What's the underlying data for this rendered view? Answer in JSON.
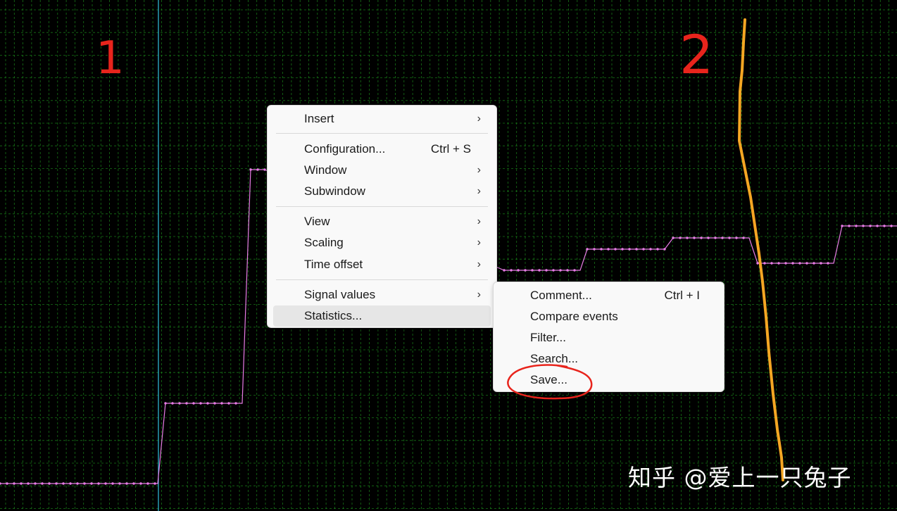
{
  "colors": {
    "background": "#000000",
    "grid": "#1f9a1f",
    "signal": "#e87ce6",
    "cursor": "#33c3e0",
    "annotation_red": "#e8241c",
    "annotation_orange": "#f5a623"
  },
  "annotations": {
    "marker_1": "1",
    "marker_2": "2"
  },
  "context_menu": {
    "items": [
      {
        "label": "Insert",
        "shortcut": "",
        "arrow": "›"
      },
      {
        "label": "Configuration...",
        "shortcut": "Ctrl + S",
        "arrow": ""
      },
      {
        "label": "Window",
        "shortcut": "",
        "arrow": "›"
      },
      {
        "label": "Subwindow",
        "shortcut": "",
        "arrow": "›"
      },
      {
        "label": "View",
        "shortcut": "",
        "arrow": "›"
      },
      {
        "label": "Scaling",
        "shortcut": "",
        "arrow": "›"
      },
      {
        "label": "Time offset",
        "shortcut": "",
        "arrow": "›"
      },
      {
        "label": "Signal values",
        "shortcut": "",
        "arrow": "›"
      },
      {
        "label": "Statistics...",
        "shortcut": "",
        "arrow": ""
      }
    ]
  },
  "submenu": {
    "items": [
      {
        "label": "Comment...",
        "shortcut": "Ctrl + I"
      },
      {
        "label": "Compare events",
        "shortcut": ""
      },
      {
        "label": "Filter...",
        "shortcut": ""
      },
      {
        "label": "Search...",
        "shortcut": ""
      },
      {
        "label": "Save...",
        "shortcut": ""
      }
    ]
  },
  "watermark": "知乎 @爱上一只兔子"
}
